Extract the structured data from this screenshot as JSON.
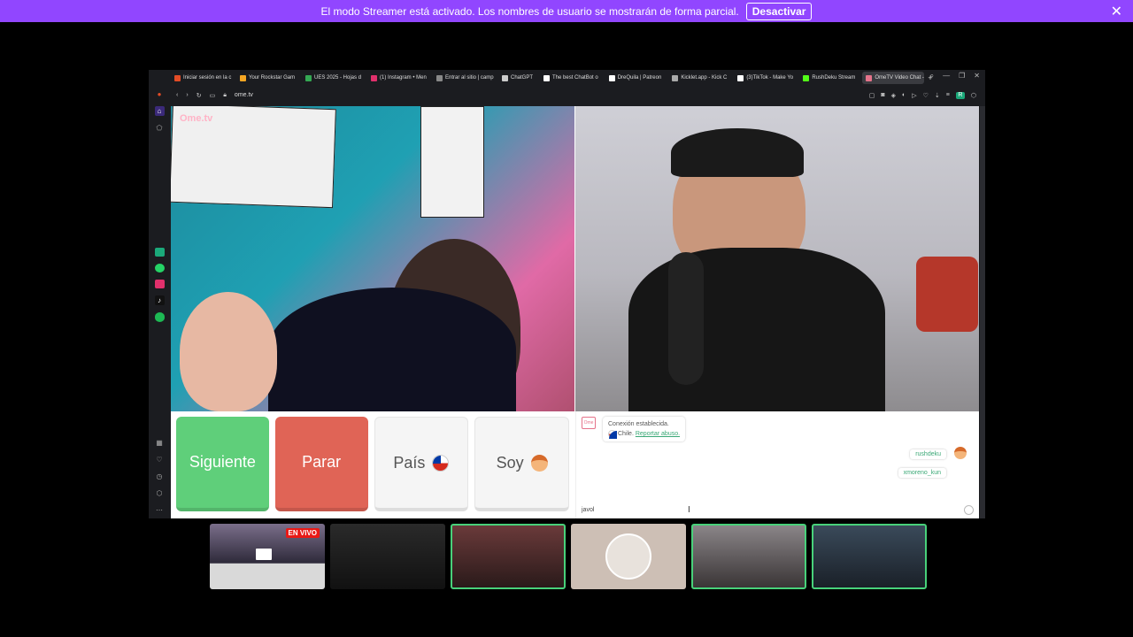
{
  "banner": {
    "message": "El modo Streamer está activado. Los nombres de usuario se mostrarán de forma parcial.",
    "button": "Desactivar",
    "close_icon": "close-icon"
  },
  "browser": {
    "tabs": [
      {
        "label": "Iniciar sesión en la c",
        "color": "#e34c26"
      },
      {
        "label": "Your Rockstar Gam",
        "color": "#f5a623"
      },
      {
        "label": "UES 2025 - Hojas d",
        "color": "#34a853"
      },
      {
        "label": "(1) Instagram • Men",
        "color": "#e1306c"
      },
      {
        "label": "Entrar al sitio | camp",
        "color": "#888888"
      },
      {
        "label": "ChatGPT",
        "color": "#cccccc"
      },
      {
        "label": "The best ChatBot o",
        "color": "#ffffff"
      },
      {
        "label": "DreQuila | Patreon",
        "color": "#ffffff"
      },
      {
        "label": "Kicklet.app - Kick C",
        "color": "#aaaaaa"
      },
      {
        "label": "(3)TikTok - Make Yo",
        "color": "#ffffff"
      },
      {
        "label": "RushDeku Stream",
        "color": "#53fc18"
      },
      {
        "label": "OmeTV Video Chat -",
        "color": "#e5738a",
        "active": true
      }
    ],
    "url": "ome.tv"
  },
  "video": {
    "logo": "Ome.tv"
  },
  "controls": {
    "next": "Siguiente",
    "stop": "Parar",
    "country": "País",
    "me": "Soy"
  },
  "chat": {
    "status": "Conexión establecida.",
    "country": "Chile.",
    "report": "Reportar abuso.",
    "user1": "rushdeku",
    "user2": "xmoreno_kun",
    "typed": "javol"
  },
  "thumbnails": {
    "live_badge": "EN VIVO"
  },
  "colors": {
    "banner": "#9146ff",
    "next": "#5fcf7a",
    "stop": "#e06456",
    "link": "#3aa876"
  }
}
